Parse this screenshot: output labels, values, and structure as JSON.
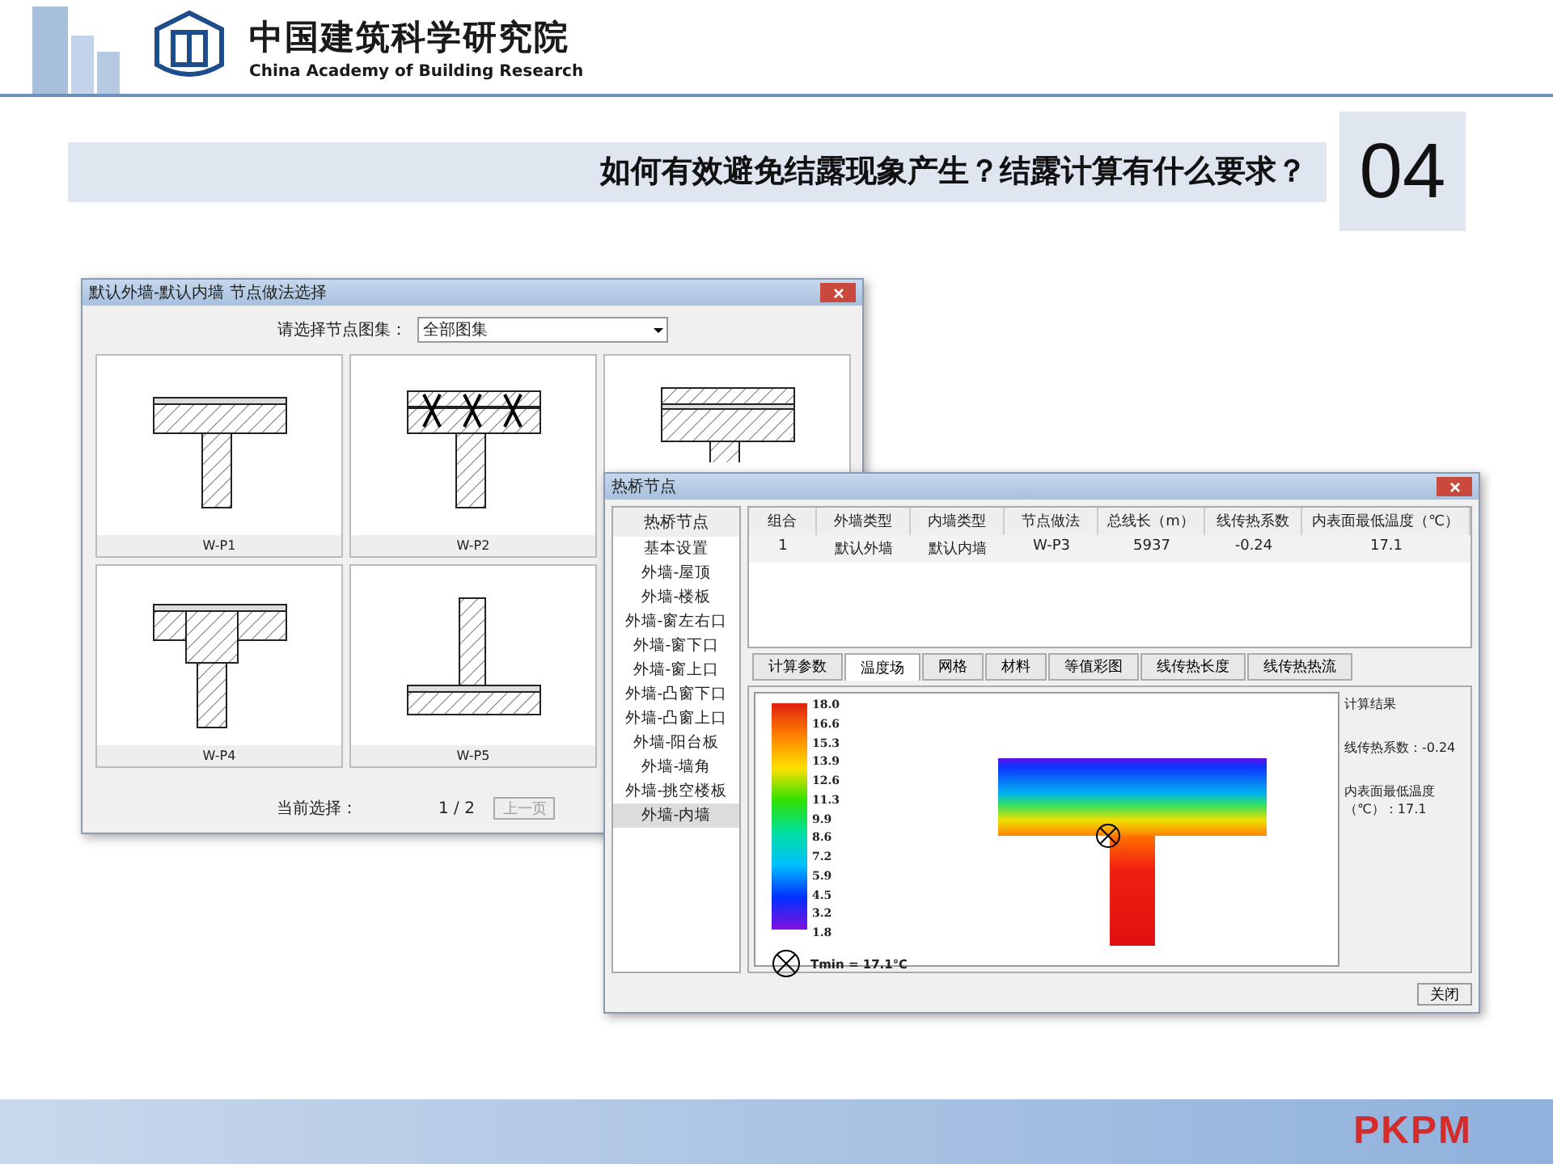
{
  "header": {
    "org_name_cn": "中国建筑科学研究院",
    "org_name_en": "China Academy of Building Research"
  },
  "title": {
    "text": "如何有效避免结露现象产生？结露计算有什么要求？",
    "number": "04"
  },
  "node_window": {
    "title": "默认外墙-默认内墙 节点做法选择",
    "atlas_label": "请选择节点图集：",
    "atlas_value": "全部图集",
    "tiles": [
      {
        "kind": "t-slab",
        "label": "W-P1"
      },
      {
        "kind": "t-marked",
        "label": "W-P2"
      },
      {
        "kind": "t-layered"
      },
      {
        "kind": "t-split",
        "label": "W-P4"
      },
      {
        "kind": "inverted-t",
        "label": "W-P5"
      }
    ],
    "current_label": "当前选择：",
    "page": "1 / 2",
    "prev_button": "上一页"
  },
  "bridge_window": {
    "title": "热桥节点",
    "sidebar_header": "热桥节点",
    "sidebar_items": [
      {
        "label": "基本设置",
        "selected": false
      },
      {
        "label": "外墙-屋顶",
        "selected": false
      },
      {
        "label": "外墙-楼板",
        "selected": false
      },
      {
        "label": "外墙-窗左右口",
        "selected": false
      },
      {
        "label": "外墙-窗下口",
        "selected": false
      },
      {
        "label": "外墙-窗上口",
        "selected": false
      },
      {
        "label": "外墙-凸窗下口",
        "selected": false
      },
      {
        "label": "外墙-凸窗上口",
        "selected": false
      },
      {
        "label": "外墙-阳台板",
        "selected": false
      },
      {
        "label": "外墙-墙角",
        "selected": false
      },
      {
        "label": "外墙-挑空楼板",
        "selected": false
      },
      {
        "label": "外墙-内墙",
        "selected": true
      }
    ],
    "table": {
      "columns": [
        "组合",
        "外墙类型",
        "内墙类型",
        "节点做法",
        "总线长（m）",
        "线传热系数",
        "内表面最低温度（℃）"
      ],
      "rows": [
        [
          "1",
          "默认外墙",
          "默认内墙",
          "W-P3",
          "5937",
          "-0.24",
          "17.1"
        ]
      ]
    },
    "tabs": [
      {
        "label": "计算参数",
        "selected": false
      },
      {
        "label": "温度场",
        "selected": true
      },
      {
        "label": "网格",
        "selected": false
      },
      {
        "label": "材料",
        "selected": false
      },
      {
        "label": "等值彩图",
        "selected": false
      },
      {
        "label": "线传热长度",
        "selected": false
      },
      {
        "label": "线传热热流",
        "selected": false
      }
    ],
    "legend_values": [
      "18.0",
      "16.6",
      "15.3",
      "13.9",
      "12.6",
      "11.3",
      "9.9",
      "8.6",
      "7.2",
      "5.9",
      "4.5",
      "3.2",
      "1.8"
    ],
    "tmin": "Tmin = 17.1℃",
    "results": {
      "title": "计算结果",
      "coefficient": "线传热系数：-0.24",
      "min_temp": "内表面最低温度（℃）：17.1"
    },
    "close_button": "关闭"
  },
  "footer": {
    "logo": "PKPM"
  }
}
